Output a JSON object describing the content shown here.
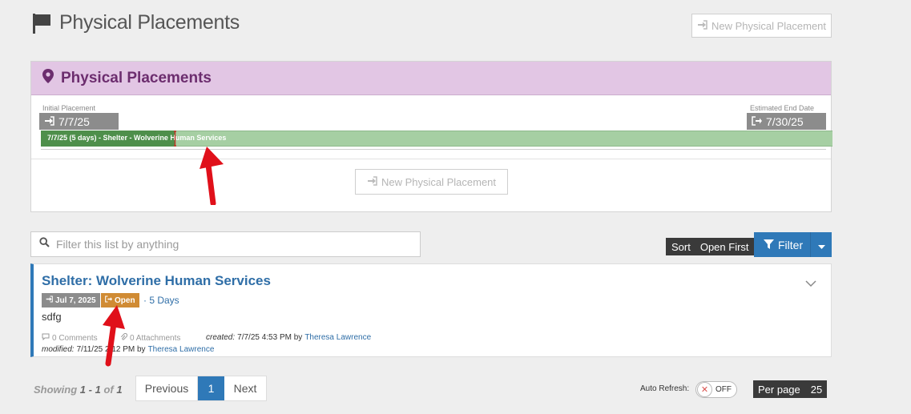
{
  "header": {
    "title": "Physical Placements",
    "new_button": "New Physical Placement"
  },
  "panel": {
    "title": "Physical Placements",
    "initial_label": "Initial Placement",
    "initial_date": "7/7/25",
    "end_label": "Estimated End Date",
    "end_date": "7/30/25",
    "bar_text": "7/7/25 (5 days) - Shelter - Wolverine Human Services",
    "new_button": "New Physical Placement"
  },
  "search": {
    "placeholder": "Filter this list by anything"
  },
  "sort": {
    "label": "Sort",
    "value": "Open First"
  },
  "filter": {
    "label": "Filter"
  },
  "card": {
    "title": "Shelter: Wolverine Human Services",
    "date_badge": "Jul 7, 2025",
    "status_badge": "Open",
    "duration": "· 5 Days",
    "description": "sdfg",
    "comments": "0 Comments",
    "attachments": "0 Attachments",
    "created_label": "created:",
    "created_value": "7/7/25 4:53 PM by",
    "created_by": "Theresa Lawrence",
    "modified_label": "modified:",
    "modified_value": "7/11/25 2:12 PM by",
    "modified_by": "Theresa Lawrence"
  },
  "pagination": {
    "showing_label": "Showing",
    "range": "1 - 1",
    "of_label": "of",
    "total": "1",
    "previous": "Previous",
    "current": "1",
    "next": "Next"
  },
  "auto_refresh": {
    "label": "Auto Refresh:",
    "state": "OFF"
  },
  "per_page": {
    "label": "Per page",
    "value": "25"
  },
  "colors": {
    "accent": "#2f79b8",
    "panel_header": "#e2c6e4",
    "open_badge": "#d08b34",
    "bar": "#4e8f4b",
    "annotation": "#e0101a"
  },
  "icons": [
    "flag-icon",
    "map-marker-icon",
    "sign-in-icon",
    "sign-out-icon",
    "search-icon",
    "filter-icon",
    "chevron-down-icon",
    "comment-icon",
    "paperclip-icon"
  ]
}
